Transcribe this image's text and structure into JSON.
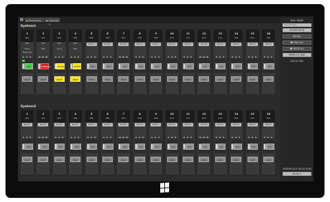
{
  "tabs": [
    {
      "label": "Production"
    },
    {
      "label": "Channel 2"
    }
  ],
  "systems": [
    {
      "label": "System1",
      "channels": [
        {
          "num": "1",
          "code": "001",
          "select": "",
          "extra": [
            "582",
            "",
            "Dave",
            "Technical"
          ],
          "ptt": "ON",
          "ptt_color": "green",
          "drop": "DROP",
          "drop_color": ""
        },
        {
          "num": "2",
          "code": "002",
          "select": "",
          "extra": [
            "315",
            "",
            "415",
            ""
          ],
          "ptt": "CONNECT",
          "ptt_color": "red",
          "drop": "DROP",
          "drop_color": ""
        },
        {
          "num": "3",
          "code": "003",
          "select": "",
          "extra": [
            "527",
            "",
            "Anna",
            ""
          ],
          "ptt": "CALLING",
          "ptt_color": "yellow",
          "drop": "DROP",
          "drop_color": "yellow"
        },
        {
          "num": "4",
          "code": "004",
          "select": "",
          "extra": [
            "553",
            "",
            "602",
            ""
          ],
          "ptt": "ACCEPT",
          "ptt_color": "yellow",
          "drop": "DROP",
          "drop_color": "yellow"
        },
        {
          "num": "5",
          "code": "005",
          "select": "SELECT",
          "extra": [],
          "ptt": "PTT",
          "ptt_color": "",
          "drop": "DROP",
          "drop_color": ""
        },
        {
          "num": "6",
          "code": "006",
          "select": "SELECT",
          "extra": [],
          "ptt": "PTT",
          "ptt_color": "",
          "drop": "DROP",
          "drop_color": ""
        },
        {
          "num": "7",
          "code": "007",
          "select": "SELECT",
          "extra": [],
          "ptt": "PTT",
          "ptt_color": "",
          "drop": "DROP",
          "drop_color": ""
        },
        {
          "num": "8",
          "code": "008",
          "select": "SELECT",
          "extra": [],
          "ptt": "PTT",
          "ptt_color": "",
          "drop": "DROP",
          "drop_color": ""
        },
        {
          "num": "9",
          "code": "009",
          "select": "SELECT",
          "extra": [],
          "ptt": "PTT",
          "ptt_color": "",
          "drop": "DROP",
          "drop_color": ""
        },
        {
          "num": "10",
          "code": "010",
          "select": "SELECT",
          "extra": [],
          "ptt": "PTT",
          "ptt_color": "",
          "drop": "DROP",
          "drop_color": ""
        },
        {
          "num": "11",
          "code": "011",
          "select": "SELECT",
          "extra": [],
          "ptt": "PTT",
          "ptt_color": "",
          "drop": "DROP",
          "drop_color": ""
        },
        {
          "num": "12",
          "code": "012",
          "select": "SELECT",
          "extra": [],
          "ptt": "PTT",
          "ptt_color": "",
          "drop": "DROP",
          "drop_color": ""
        },
        {
          "num": "13",
          "code": "013",
          "select": "SELECT",
          "extra": [],
          "ptt": "PTT",
          "ptt_color": "",
          "drop": "DROP",
          "drop_color": ""
        },
        {
          "num": "14",
          "code": "014",
          "select": "SELECT",
          "extra": [],
          "ptt": "PTT",
          "ptt_color": "",
          "drop": "DROP",
          "drop_color": ""
        },
        {
          "num": "15",
          "code": "015",
          "select": "SELECT",
          "extra": [],
          "ptt": "PTT",
          "ptt_color": "",
          "drop": "DROP",
          "drop_color": ""
        },
        {
          "num": "16",
          "code": "016",
          "select": "SELECT",
          "extra": [],
          "ptt": "PTT",
          "ptt_color": "",
          "drop": "DROP",
          "drop_color": ""
        }
      ]
    },
    {
      "label": "System2",
      "channels": [
        {
          "num": "1",
          "code": "001",
          "select": "SELECT",
          "extra": [],
          "ptt": "PTT",
          "ptt_color": "",
          "drop": "DROP",
          "drop_color": ""
        },
        {
          "num": "2",
          "code": "002",
          "select": "SELECT",
          "extra": [],
          "ptt": "PTT",
          "ptt_color": "",
          "drop": "DROP",
          "drop_color": ""
        },
        {
          "num": "3",
          "code": "003",
          "select": "SELECT",
          "extra": [],
          "ptt": "PTT",
          "ptt_color": "",
          "drop": "DROP",
          "drop_color": ""
        },
        {
          "num": "4",
          "code": "004",
          "select": "SELECT",
          "extra": [],
          "ptt": "PTT",
          "ptt_color": "",
          "drop": "DROP",
          "drop_color": ""
        },
        {
          "num": "5",
          "code": "005",
          "select": "SELECT",
          "extra": [],
          "ptt": "PTT",
          "ptt_color": "",
          "drop": "DROP",
          "drop_color": ""
        },
        {
          "num": "6",
          "code": "006",
          "select": "SELECT",
          "extra": [],
          "ptt": "PTT",
          "ptt_color": "",
          "drop": "DROP",
          "drop_color": ""
        },
        {
          "num": "7",
          "code": "007",
          "select": "SELECT",
          "extra": [],
          "ptt": "PTT",
          "ptt_color": "",
          "drop": "DROP",
          "drop_color": ""
        },
        {
          "num": "8",
          "code": "008",
          "select": "SELECT",
          "extra": [],
          "ptt": "PTT",
          "ptt_color": "",
          "drop": "DROP",
          "drop_color": ""
        },
        {
          "num": "9",
          "code": "009",
          "select": "SELECT",
          "extra": [],
          "ptt": "PTT",
          "ptt_color": "",
          "drop": "DROP",
          "drop_color": ""
        },
        {
          "num": "10",
          "code": "010",
          "select": "SELECT",
          "extra": [],
          "ptt": "PTT",
          "ptt_color": "",
          "drop": "DROP",
          "drop_color": ""
        },
        {
          "num": "11",
          "code": "011",
          "select": "SELECT",
          "extra": [],
          "ptt": "PTT",
          "ptt_color": "",
          "drop": "DROP",
          "drop_color": ""
        },
        {
          "num": "12",
          "code": "012",
          "select": "SELECT",
          "extra": [],
          "ptt": "PTT",
          "ptt_color": "",
          "drop": "DROP",
          "drop_color": ""
        },
        {
          "num": "13",
          "code": "013",
          "select": "SELECT",
          "extra": [],
          "ptt": "PTT",
          "ptt_color": "",
          "drop": "DROP",
          "drop_color": ""
        },
        {
          "num": "14",
          "code": "014",
          "select": "SELECT",
          "extra": [],
          "ptt": "PTT",
          "ptt_color": "",
          "drop": "DROP",
          "drop_color": ""
        },
        {
          "num": "15",
          "code": "015",
          "select": "SELECT",
          "extra": [],
          "ptt": "PTT",
          "ptt_color": "",
          "drop": "DROP",
          "drop_color": ""
        },
        {
          "num": "16",
          "code": "016",
          "select": "SELECT",
          "extra": [],
          "ptt": "PTT",
          "ptt_color": "",
          "drop": "DROP",
          "drop_color": ""
        }
      ]
    }
  ],
  "right_panel": {
    "title": "DIAL NAME",
    "input_placeholder": "Dial Number",
    "buttons": [
      {
        "label": "PHONE BOOK",
        "icon": ""
      },
      {
        "label": "REDIAL",
        "icon": ""
      },
      {
        "label": "DIAL ALL",
        "icon": "phone-icon"
      },
      {
        "label": "DROP ALL",
        "icon": "phone-hangup-icon"
      },
      {
        "label": "PARALLEL DIAL",
        "icon": ""
      }
    ],
    "quick_dial_label": "QUICK DIAL",
    "workspace_title": "WORKPLACE SELECTION",
    "workspace_button": "Studio 1"
  },
  "colors": {
    "red": "#d6242a",
    "yellow": "#f4e020",
    "green": "#3fcf3f",
    "bg": "#2b2b2b"
  }
}
